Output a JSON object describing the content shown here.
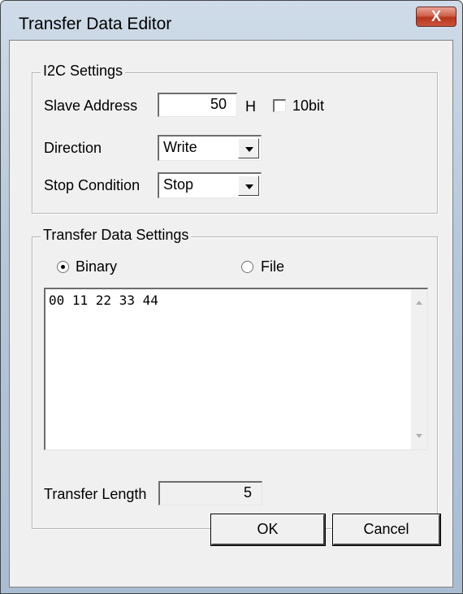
{
  "window": {
    "title": "Transfer Data Editor",
    "close_label": "X"
  },
  "i2c": {
    "group_label": "I2C Settings",
    "slave_address_label": "Slave Address",
    "slave_address_value": "50",
    "hex_suffix": "H",
    "tenbit_label": "10bit",
    "tenbit_checked": false,
    "direction_label": "Direction",
    "direction_value": "Write",
    "stop_label": "Stop Condition",
    "stop_value": "Stop"
  },
  "transfer": {
    "group_label": "Transfer Data Settings",
    "binary_label": "Binary",
    "file_label": "File",
    "selected_mode": "Binary",
    "data_text": "00 11 22 33 44",
    "length_label": "Transfer Length",
    "length_value": "5"
  },
  "buttons": {
    "ok": "OK",
    "cancel": "Cancel"
  }
}
